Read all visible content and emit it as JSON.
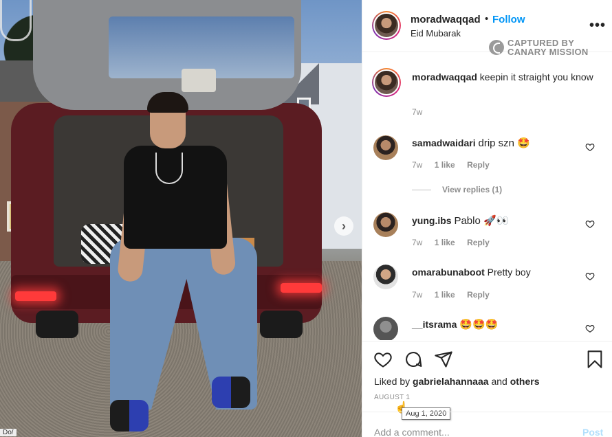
{
  "post": {
    "username": "moradwaqqad",
    "dot": "•",
    "follow_label": "Follow",
    "subtitle": "Eid Mubarak",
    "more_label": "•••"
  },
  "watermark": {
    "line1": "CAPTURED BY",
    "line2": "CANARY MISSION"
  },
  "caption": {
    "username": "moradwaqqad",
    "text": "keepin it straight you know",
    "time": "7w"
  },
  "comments": [
    {
      "username": "samadwaidari",
      "text": "drip szn 🤩",
      "time": "7w",
      "likes": "1 like",
      "reply": "Reply",
      "view_replies": "View replies (1)"
    },
    {
      "username": "yung.ibs",
      "text": "Pablo 🚀👀",
      "time": "7w",
      "likes": "1 like",
      "reply": "Reply"
    },
    {
      "username": "omarabunaboot",
      "text": "Pretty boy",
      "time": "7w",
      "likes": "1 like",
      "reply": "Reply"
    },
    {
      "username": "__itsrama",
      "text": "🤩🤩🤩"
    }
  ],
  "actions": {
    "liked_prefix": "Liked by",
    "liked_user": "gabrielahannaaa",
    "liked_and": "and",
    "liked_others": "others",
    "date_label": "AUGUST 1",
    "tooltip": "Aug 1, 2020"
  },
  "add_comment": {
    "placeholder": "Add a comment...",
    "post_label": "Post"
  },
  "photo": {
    "corner_text": "Do/",
    "next_label": "›"
  },
  "colors": {
    "follow": "#0095f6",
    "muted": "#8e8e8e",
    "post_disabled": "#b2dffc"
  },
  "icons": [
    "heart-icon",
    "comment-icon",
    "share-icon",
    "bookmark-icon",
    "more-icon",
    "next-arrow-icon",
    "canary-mission-icon",
    "cursor-hand-icon"
  ]
}
